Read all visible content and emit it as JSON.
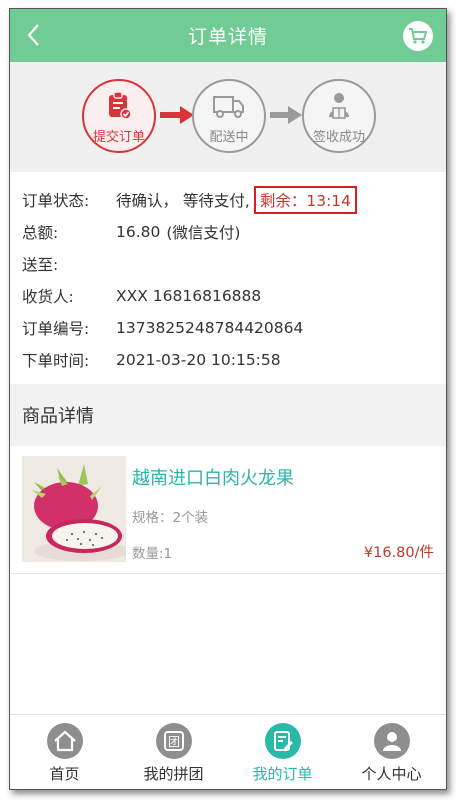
{
  "header": {
    "title": "订单详情"
  },
  "steps": [
    {
      "label": "提交订单",
      "active": true
    },
    {
      "label": "配送中",
      "active": false
    },
    {
      "label": "签收成功",
      "active": false
    }
  ],
  "order": {
    "status_key": "订单状态:",
    "status_value": "待确认， 等待支付,",
    "remaining": "剩余：13:14",
    "total_key": "总额:",
    "total_value": "16.80",
    "total_note": "(微信支付)",
    "address_key": "送至:",
    "address_value": "",
    "receiver_key": "收货人:",
    "receiver_value": "XXX 16816816888",
    "order_no_key": "订单编号:",
    "order_no_value": "1373825248784420864",
    "time_key": "下单时间:",
    "time_value": "2021-03-20 10:15:58"
  },
  "products_section": {
    "title": "商品详情"
  },
  "product": {
    "name": "越南进口白肉火龙果",
    "spec": "规格：2个装",
    "quantity": "数量:1",
    "price": "¥16.80/件"
  },
  "tabbar": [
    {
      "label": "首页",
      "icon": "home-icon",
      "active": false
    },
    {
      "label": "我的拼团",
      "icon": "group-icon",
      "active": false
    },
    {
      "label": "我的订单",
      "icon": "order-icon",
      "active": true
    },
    {
      "label": "个人中心",
      "icon": "user-icon",
      "active": false
    }
  ],
  "colors": {
    "header": "#70cc94",
    "accent": "#2ab8a8",
    "red": "#c0392b"
  }
}
